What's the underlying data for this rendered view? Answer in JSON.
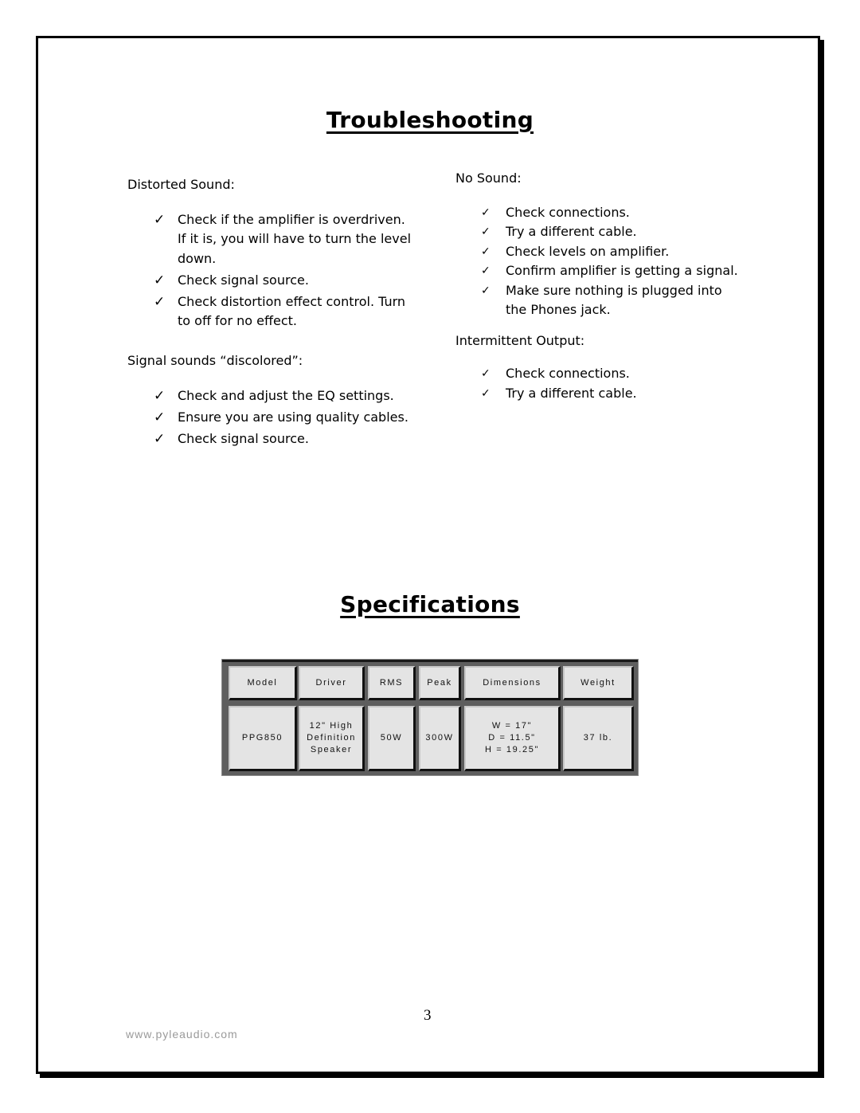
{
  "troubleshooting": {
    "title": "Troubleshooting",
    "left_column": {
      "sections": [
        {
          "heading": "Distorted Sound:",
          "items": [
            "Check if the amplifier is overdriven. If it is, you will have to turn the level down.",
            "Check signal source.",
            "Check distortion effect control. Turn to off for no effect."
          ]
        },
        {
          "heading": "Signal sounds “discolored”:",
          "items": [
            "Check and adjust the EQ settings.",
            "Ensure you are using quality cables.",
            "Check signal source."
          ]
        }
      ]
    },
    "right_column": {
      "sections": [
        {
          "heading": "No Sound:",
          "items": [
            "Check connections.",
            "Try a different cable.",
            "Check levels on amplifier.",
            "Confirm amplifier is getting a signal.",
            "Make sure nothing is plugged into the Phones jack."
          ]
        },
        {
          "heading": "Intermittent Output:",
          "items": [
            "Check connections.",
            "Try a different cable."
          ]
        }
      ]
    },
    "check_icon": "✓"
  },
  "specifications": {
    "title": "Specifications",
    "headers": [
      "Model",
      "Driver",
      "RMS",
      "Peak",
      "Dimensions",
      "Weight"
    ],
    "rows": [
      [
        "PPG850",
        "12\" High\nDefinition\nSpeaker",
        "50W",
        "300W",
        "W = 17\"\nD = 11.5\"\nH = 19.25\"",
        "37 lb."
      ]
    ]
  },
  "footer": {
    "page_number": "3",
    "url": "www.pyleaudio.com"
  }
}
